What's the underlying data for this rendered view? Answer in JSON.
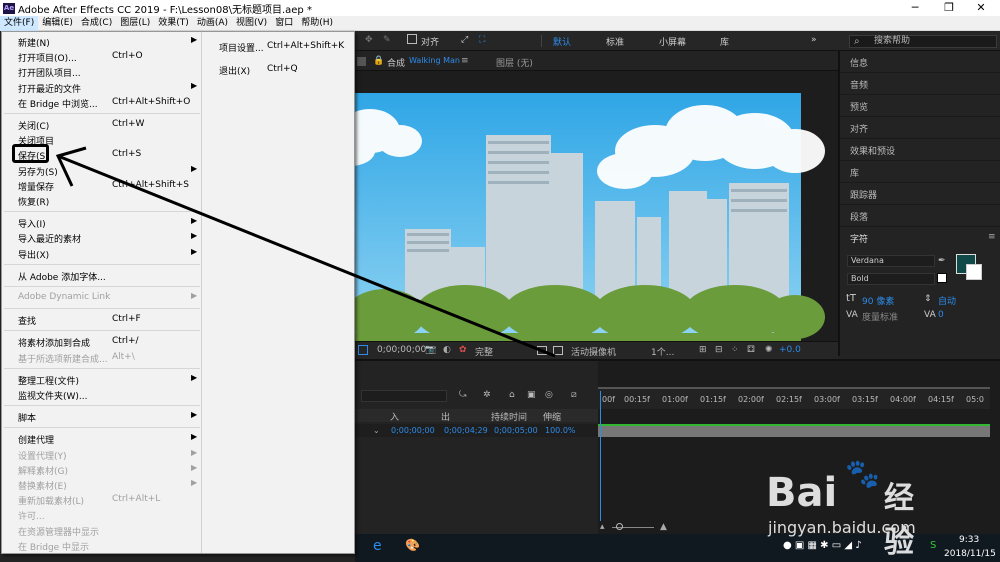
{
  "window": {
    "title": "Adobe After Effects CC 2019 - F:\\Lesson08\\无标题项目.aep *",
    "logo": "Ae",
    "minimize": "─",
    "restore": "❐",
    "close": "✕"
  },
  "menubar": [
    "文件(F)",
    "编辑(E)",
    "合成(C)",
    "图层(L)",
    "效果(T)",
    "动画(A)",
    "视图(V)",
    "窗口",
    "帮助(H)"
  ],
  "toolbar": {
    "snap_label": "对齐",
    "workspaces": [
      "默认",
      "标准",
      "小屏幕",
      "库"
    ],
    "search_placeholder": "搜索帮助",
    "more": "»"
  },
  "file_menu": {
    "items": [
      {
        "label": "新建(N)",
        "shortcut": "",
        "submenu": true,
        "disabled": false
      },
      {
        "label": "打开项目(O)...",
        "shortcut": "Ctrl+O",
        "submenu": false,
        "disabled": false
      },
      {
        "label": "打开团队项目...",
        "shortcut": "",
        "submenu": false,
        "disabled": false
      },
      {
        "label": "打开最近的文件",
        "shortcut": "",
        "submenu": true,
        "disabled": false
      },
      {
        "label": "在 Bridge 中浏览...",
        "shortcut": "Ctrl+Alt+Shift+O",
        "submenu": false,
        "disabled": false
      },
      {
        "label": "关闭(C)",
        "shortcut": "Ctrl+W",
        "submenu": false,
        "disabled": false
      },
      {
        "label": "关闭项目",
        "shortcut": "",
        "submenu": false,
        "disabled": false
      },
      {
        "label": "保存(S)",
        "shortcut": "Ctrl+S",
        "submenu": false,
        "disabled": false
      },
      {
        "label": "另存为(S)",
        "shortcut": "",
        "submenu": true,
        "disabled": false
      },
      {
        "label": "增量保存",
        "shortcut": "Ctrl+Alt+Shift+S",
        "submenu": false,
        "disabled": false
      },
      {
        "label": "恢复(R)",
        "shortcut": "",
        "submenu": false,
        "disabled": false
      },
      {
        "label": "导入(I)",
        "shortcut": "",
        "submenu": true,
        "disabled": false
      },
      {
        "label": "导入最近的素材",
        "shortcut": "",
        "submenu": true,
        "disabled": false
      },
      {
        "label": "导出(X)",
        "shortcut": "",
        "submenu": true,
        "disabled": false
      },
      {
        "label": "从 Adobe 添加字体...",
        "shortcut": "",
        "submenu": false,
        "disabled": false
      },
      {
        "label": "Adobe Dynamic Link",
        "shortcut": "",
        "submenu": true,
        "disabled": true
      },
      {
        "label": "查找",
        "shortcut": "Ctrl+F",
        "submenu": false,
        "disabled": false
      },
      {
        "label": "将素材添加到合成",
        "shortcut": "Ctrl+/",
        "submenu": false,
        "disabled": false
      },
      {
        "label": "基于所选项新建合成...",
        "shortcut": "Alt+\\",
        "submenu": false,
        "disabled": true
      },
      {
        "label": "整理工程(文件)",
        "shortcut": "",
        "submenu": true,
        "disabled": false
      },
      {
        "label": "监视文件夹(W)...",
        "shortcut": "",
        "submenu": false,
        "disabled": false
      },
      {
        "label": "脚本",
        "shortcut": "",
        "submenu": true,
        "disabled": false
      },
      {
        "label": "创建代理",
        "shortcut": "",
        "submenu": true,
        "disabled": false
      },
      {
        "label": "设置代理(Y)",
        "shortcut": "",
        "submenu": true,
        "disabled": true
      },
      {
        "label": "解释素材(G)",
        "shortcut": "",
        "submenu": true,
        "disabled": true
      },
      {
        "label": "替换素材(E)",
        "shortcut": "",
        "submenu": true,
        "disabled": true
      },
      {
        "label": "重新加载素材(L)",
        "shortcut": "Ctrl+Alt+L",
        "submenu": false,
        "disabled": true
      },
      {
        "label": "许可...",
        "shortcut": "",
        "submenu": false,
        "disabled": true
      },
      {
        "label": "在资源管理器中显示",
        "shortcut": "",
        "submenu": false,
        "disabled": true
      },
      {
        "label": "在 Bridge 中显示",
        "shortcut": "",
        "submenu": false,
        "disabled": true
      }
    ],
    "side_items": [
      {
        "label": "项目设置...",
        "shortcut": "Ctrl+Alt+Shift+K"
      },
      {
        "label": "退出(X)",
        "shortcut": "Ctrl+Q"
      }
    ]
  },
  "comp_panel": {
    "tab_prefix": "合成",
    "comp_name": "Walking Man",
    "menu_icon": "≡",
    "layer_tab": "图层 (无)"
  },
  "viewer_bar": {
    "timecode": "0;00;00;00",
    "resolution": "完整",
    "camera": "活动摄像机",
    "views": "1个...",
    "exposure": "+0.0"
  },
  "right_panels": [
    "信息",
    "音频",
    "预览",
    "对齐",
    "效果和预设",
    "库",
    "跟踪器",
    "段落"
  ],
  "character_panel": {
    "title": "字符",
    "font": "Verdana",
    "style": "Bold",
    "size": "90 像素",
    "leading": "自动",
    "kerning": "度量标准",
    "tracking": "0",
    "fill_color": "#0f4a48"
  },
  "timeline": {
    "columns": [
      "入",
      "出",
      "持续时间",
      "伸缩"
    ],
    "row": {
      "in": "0;00;00;00",
      "out": "0;00;04;29",
      "duration": "0;00;05;00",
      "stretch": "100.0%"
    },
    "ticks": [
      "00f",
      "00:15f",
      "01:00f",
      "01:15f",
      "02:00f",
      "02:15f",
      "03:00f",
      "03:15f",
      "04:00f",
      "04:15f",
      "05:0"
    ]
  },
  "taskbar": {
    "time": "9:33",
    "date": "2018/11/15"
  },
  "watermark": {
    "brand": "Bai",
    "brand2": "经验",
    "url": "jingyan.baidu.com"
  }
}
